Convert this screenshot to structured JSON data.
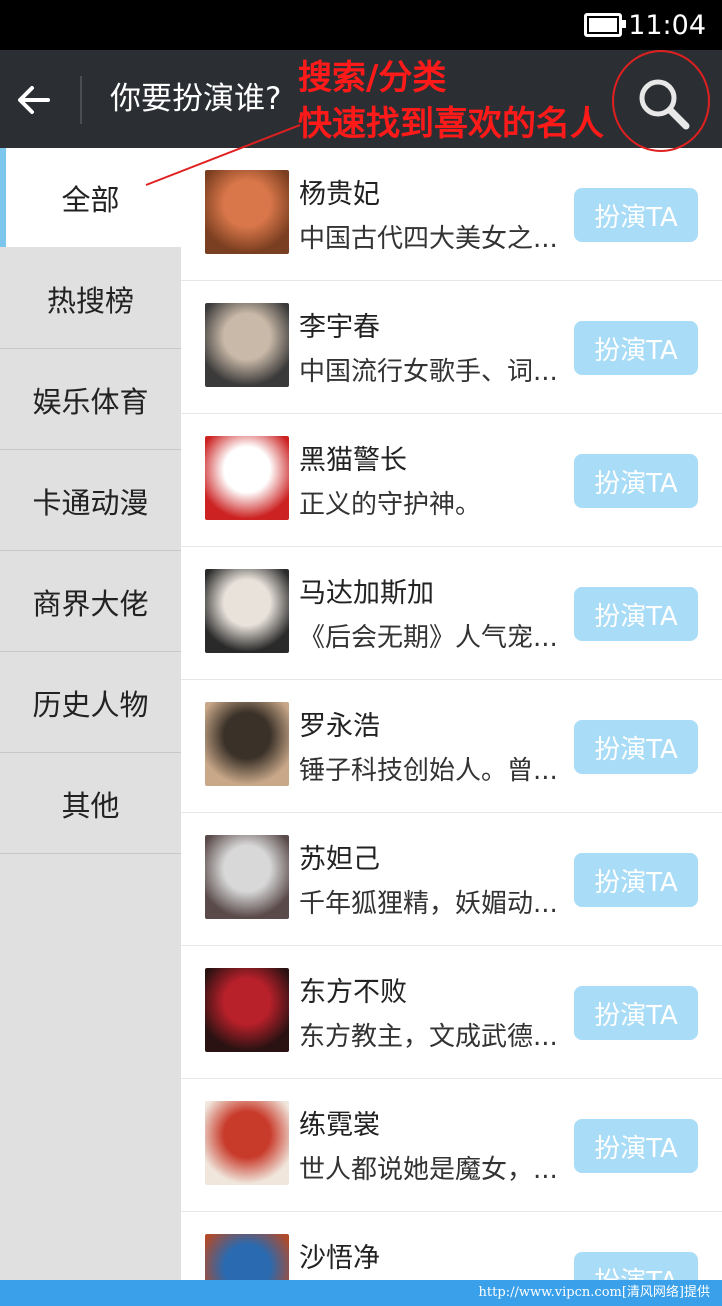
{
  "status": {
    "time": "11:04",
    "battery_icon": "battery-icon"
  },
  "appbar": {
    "title": "你要扮演谁?",
    "back_icon": "arrow-left-icon",
    "search_icon": "search-icon"
  },
  "annotation": {
    "line1": "搜索/分类",
    "line2": "快速找到喜欢的名人",
    "color": "#ff1a1a"
  },
  "categories": [
    {
      "label": "全部",
      "active": true
    },
    {
      "label": "热搜榜",
      "active": false
    },
    {
      "label": "娱乐体育",
      "active": false
    },
    {
      "label": "卡通动漫",
      "active": false
    },
    {
      "label": "商界大佬",
      "active": false
    },
    {
      "label": "历史人物",
      "active": false
    },
    {
      "label": "其他",
      "active": false
    }
  ],
  "items": [
    {
      "name": "杨贵妃",
      "desc": "中国古代四大美女之...",
      "button": "扮演TA",
      "avatar_colors": [
        "#d9774a",
        "#7a3e20"
      ]
    },
    {
      "name": "李宇春",
      "desc": "中国流行女歌手、词...",
      "button": "扮演TA",
      "avatar_colors": [
        "#c9b9a8",
        "#3b3a3a"
      ]
    },
    {
      "name": "黑猫警长",
      "desc": "正义的守护神。",
      "button": "扮演TA",
      "avatar_colors": [
        "#ffffff",
        "#cc2222"
      ]
    },
    {
      "name": "马达加斯加",
      "desc": "《后会无期》人气宠...",
      "button": "扮演TA",
      "avatar_colors": [
        "#e8e2da",
        "#2a2a2a"
      ]
    },
    {
      "name": "罗永浩",
      "desc": "锤子科技创始人。曾...",
      "button": "扮演TA",
      "avatar_colors": [
        "#3a3128",
        "#c9a889"
      ]
    },
    {
      "name": "苏妲己",
      "desc": "千年狐狸精，妖媚动...",
      "button": "扮演TA",
      "avatar_colors": [
        "#d8d8d8",
        "#5a4a4a"
      ]
    },
    {
      "name": "东方不败",
      "desc": "东方教主，文成武德...",
      "button": "扮演TA",
      "avatar_colors": [
        "#b8202a",
        "#2a1212"
      ]
    },
    {
      "name": "练霓裳",
      "desc": "世人都说她是魔女，...",
      "button": "扮演TA",
      "avatar_colors": [
        "#c83a2a",
        "#f0e6dc"
      ]
    },
    {
      "name": "沙悟净",
      "desc": "",
      "button": "扮演TA",
      "avatar_colors": [
        "#2a6ab0",
        "#b04a2a"
      ]
    }
  ],
  "footer": {
    "text": "http://www.vipcn.com[清风网络]提供"
  },
  "colors": {
    "appbar": "#2b2f33",
    "button": "#a9dcf6",
    "sidebar": "#e0e0e0",
    "accent": "#7cc6ee",
    "footer": "#3aa0ea"
  }
}
